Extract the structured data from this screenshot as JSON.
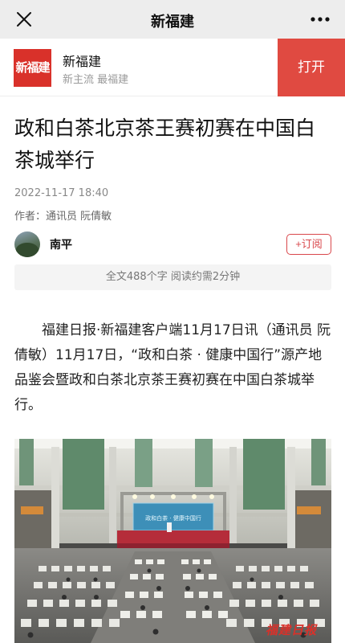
{
  "topbar": {
    "title": "新福建"
  },
  "app": {
    "logo_text": "新福建",
    "name": "新福建",
    "slogan": "新主流 最福建",
    "open_label": "打开",
    "brand_color": "#e04a41"
  },
  "article": {
    "title": "政和白茶北京茶王赛初赛在中国白茶城举行",
    "date": "2022-11-17 18:40",
    "author": "作者：通讯员 阮倩敏",
    "source_name": "南平",
    "follow_label": "+订阅",
    "stats": "全文488个字 阅读约需2分钟",
    "body": "福建日报·新福建客户端11月17日讯（通讯员 阮倩敏）11月17日，“政和白茶 · 健康中国行”源产地品鉴会暨政和白茶北京茶王赛初赛在中国白茶城举行。"
  },
  "photo": {
    "stage_screen_text": "政和白茶 · 健康中国行",
    "watermark": "福建日报"
  }
}
